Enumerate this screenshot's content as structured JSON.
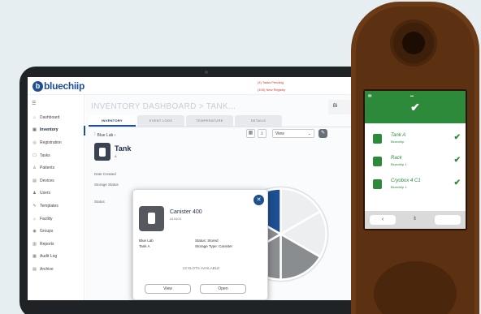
{
  "app": {
    "logo_text": "bluechiip",
    "alerts": [
      "(4) Tasks Pending",
      "(100) New Registry"
    ]
  },
  "sidebar": {
    "menu_icon": "menu-icon",
    "items": [
      {
        "label": "Dashboard",
        "icon": "dashboard-icon",
        "active": false
      },
      {
        "label": "Inventory",
        "icon": "inventory-icon",
        "active": true
      },
      {
        "label": "Registration",
        "icon": "registration-icon",
        "active": false
      },
      {
        "label": "Tasks",
        "icon": "tasks-icon",
        "active": false
      },
      {
        "label": "Patients",
        "icon": "patients-icon",
        "active": false
      },
      {
        "label": "Devices",
        "icon": "devices-icon",
        "active": false
      },
      {
        "label": "Users",
        "icon": "users-icon",
        "active": false
      },
      {
        "label": "Templates",
        "icon": "templates-icon",
        "active": false
      },
      {
        "label": "Facility",
        "icon": "facility-icon",
        "active": false
      },
      {
        "label": "Groups",
        "icon": "groups-icon",
        "active": false
      },
      {
        "label": "Reports",
        "icon": "reports-icon",
        "active": false
      },
      {
        "label": "Audit Log",
        "icon": "audit-log-icon",
        "active": false
      },
      {
        "label": "Archive",
        "icon": "archive-icon",
        "active": false
      }
    ]
  },
  "main": {
    "title": "INVENTORY DASHBOARD > TANK...",
    "user_chip": "Bi",
    "tabs": [
      "INVENTORY",
      "EVENT LOGS",
      "TEMPERATURE",
      "DETAILS"
    ],
    "breadcrumb": "Blue Lab ›",
    "view_label": "View",
    "tank": {
      "name": "Tank",
      "sub": "A",
      "date_created_label": "Date Created",
      "storage_status_label": "Storage Status",
      "status_label": "Status"
    }
  },
  "popup": {
    "title": "Canister 400",
    "code": "A10403",
    "location_label": "Blue Lab",
    "location_value": "Tank A",
    "status": "Status: Stored",
    "storage_type": "Storage Type: Canister",
    "slots": "13 SLOTS AVAILABLE",
    "view_button": "View",
    "open_button": "Open"
  },
  "device": {
    "rows": [
      {
        "title": "Tank A",
        "sub": "Bluechiip"
      },
      {
        "title": "Rack",
        "sub": "Bluechiip 1"
      },
      {
        "title": "Cryobox 4 C1",
        "sub": "Bluechiip 1"
      }
    ],
    "footer_left": "‹",
    "footer_right": ""
  },
  "pie": {
    "segments": 6,
    "highlighted_index": 5,
    "colors": {
      "filled": "#8a8d90",
      "empty": "#eceeef",
      "selected": "#1d4f91"
    },
    "filled": [
      false,
      false,
      true,
      true,
      true,
      true
    ]
  },
  "colors": {
    "brand": "#1d4f91",
    "device_green": "#2d8a3b",
    "alert": "#d2342f"
  }
}
